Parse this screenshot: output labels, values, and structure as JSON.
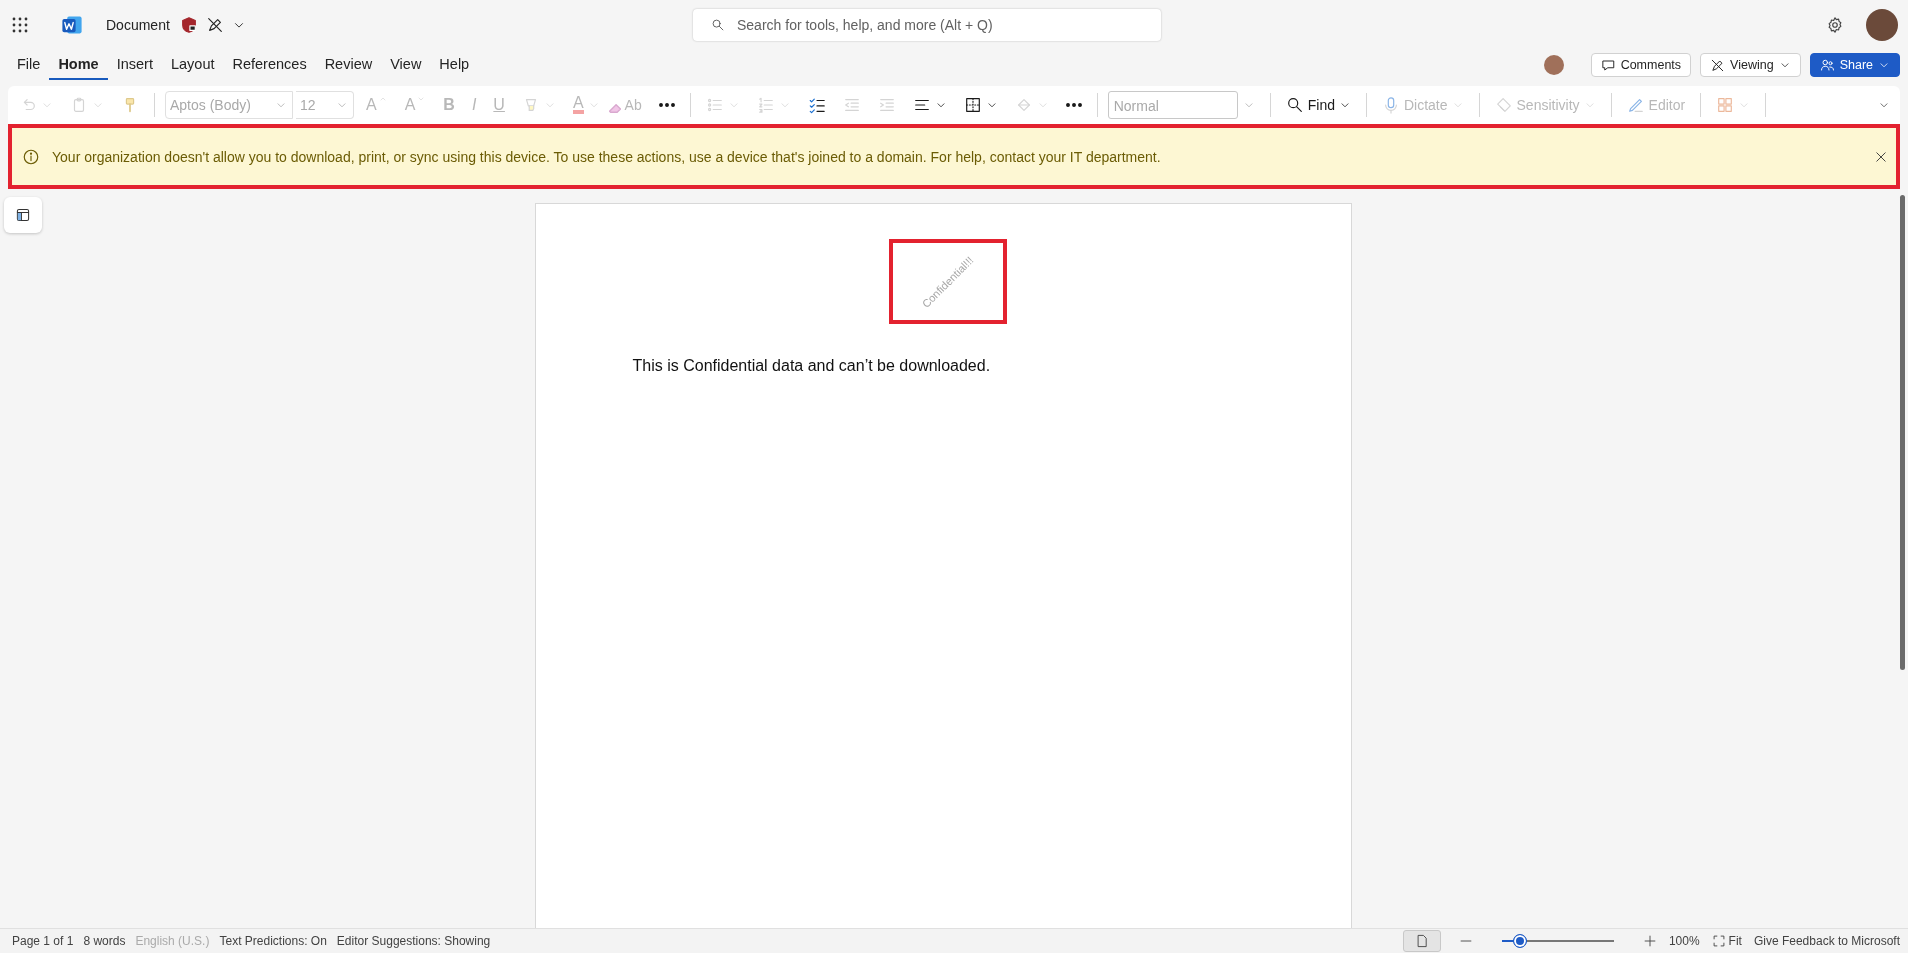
{
  "app_bar": {
    "document_title": "Document",
    "search": {
      "placeholder": "Search for tools, help, and more (Alt + Q)"
    }
  },
  "menu_tabs": [
    {
      "label": "File",
      "selected": false
    },
    {
      "label": "Home",
      "selected": true
    },
    {
      "label": "Insert",
      "selected": false
    },
    {
      "label": "Layout",
      "selected": false
    },
    {
      "label": "References",
      "selected": false
    },
    {
      "label": "Review",
      "selected": false
    },
    {
      "label": "View",
      "selected": false
    },
    {
      "label": "Help",
      "selected": false
    }
  ],
  "share_bar": {
    "comments": "Comments",
    "viewing": "Viewing",
    "share": "Share"
  },
  "toolbar": [
    {
      "kind": "undo",
      "caret": true,
      "disabled": true
    },
    {
      "kind": "paste",
      "caret": true,
      "disabled": true
    },
    {
      "kind": "painter",
      "disabled": true
    },
    {
      "kind": "separator"
    },
    {
      "kind": "font",
      "value": "Aptos (Body)",
      "disabled": true
    },
    {
      "kind": "size",
      "value": "12",
      "disabled": true
    },
    {
      "kind": "grow",
      "label": "A",
      "disabled": true
    },
    {
      "kind": "shrink",
      "label": "A",
      "disabled": true
    },
    {
      "kind": "bold",
      "label": "B",
      "disabled": true
    },
    {
      "kind": "italic",
      "label": "I",
      "disabled": true
    },
    {
      "kind": "underline",
      "label": "U",
      "disabled": true
    },
    {
      "kind": "highlight",
      "caret": true,
      "disabled": true
    },
    {
      "kind": "fontcolor",
      "label": "A",
      "caret": true,
      "disabled": true
    },
    {
      "kind": "clear",
      "label": "Ab",
      "disabled": true
    },
    {
      "kind": "more",
      "disabled": false
    },
    {
      "kind": "separator"
    },
    {
      "kind": "bullets",
      "caret": true,
      "disabled": true
    },
    {
      "kind": "numbering",
      "caret": true,
      "disabled": true
    },
    {
      "kind": "checklist",
      "disabled": false
    },
    {
      "kind": "outdent",
      "disabled": true
    },
    {
      "kind": "indent",
      "disabled": true
    },
    {
      "kind": "align",
      "caret": true,
      "disabled": false
    },
    {
      "kind": "borders",
      "caret": true,
      "disabled": false
    },
    {
      "kind": "shading",
      "caret": true,
      "disabled": true
    },
    {
      "kind": "more",
      "disabled": false
    },
    {
      "kind": "separator"
    },
    {
      "kind": "style",
      "value": "Normal",
      "disabled": true
    },
    {
      "kind": "separator"
    },
    {
      "kind": "find",
      "label": "Find",
      "caret": true,
      "disabled": false
    },
    {
      "kind": "separator"
    },
    {
      "kind": "dictate",
      "label": "Dictate",
      "caret": true,
      "disabled": true
    },
    {
      "kind": "separator"
    },
    {
      "kind": "sensitivity",
      "label": "Sensitivity",
      "caret": true,
      "disabled": true
    },
    {
      "kind": "separator"
    },
    {
      "kind": "editor",
      "label": "Editor",
      "disabled": true
    },
    {
      "kind": "separator"
    },
    {
      "kind": "addins",
      "caret": true,
      "disabled": true
    },
    {
      "kind": "separator"
    }
  ],
  "banner": {
    "message": "Your organization doesn't allow you to download, print, or sync using this device. To use these actions, use a device that's joined to a domain. For help, contact your IT department."
  },
  "document": {
    "watermark": "Confidential!!!",
    "body": "This is Confidential data and can’t be downloaded."
  },
  "status_bar": {
    "items": [
      {
        "label": "Page 1 of 1",
        "disabled": false
      },
      {
        "label": "8 words",
        "disabled": false
      },
      {
        "label": "English (U.S.)",
        "disabled": true
      },
      {
        "label": "Text Predictions: On",
        "disabled": false
      },
      {
        "label": "Editor Suggestions: Showing",
        "disabled": false
      }
    ],
    "zoom": {
      "level": 0.2,
      "reading": "100%"
    },
    "fit": "Fit",
    "feedback": "Give Feedback to Microsoft"
  }
}
